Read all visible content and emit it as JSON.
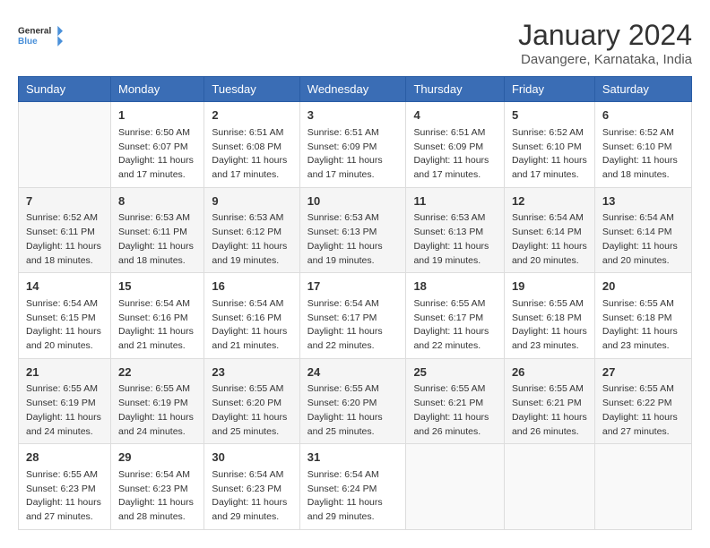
{
  "logo": {
    "general": "General",
    "blue": "Blue"
  },
  "title": "January 2024",
  "subtitle": "Davangere, Karnataka, India",
  "days_of_week": [
    "Sunday",
    "Monday",
    "Tuesday",
    "Wednesday",
    "Thursday",
    "Friday",
    "Saturday"
  ],
  "weeks": [
    [
      {
        "day": "",
        "sunrise": "",
        "sunset": "",
        "daylight": ""
      },
      {
        "day": "1",
        "sunrise": "Sunrise: 6:50 AM",
        "sunset": "Sunset: 6:07 PM",
        "daylight": "Daylight: 11 hours and 17 minutes."
      },
      {
        "day": "2",
        "sunrise": "Sunrise: 6:51 AM",
        "sunset": "Sunset: 6:08 PM",
        "daylight": "Daylight: 11 hours and 17 minutes."
      },
      {
        "day": "3",
        "sunrise": "Sunrise: 6:51 AM",
        "sunset": "Sunset: 6:09 PM",
        "daylight": "Daylight: 11 hours and 17 minutes."
      },
      {
        "day": "4",
        "sunrise": "Sunrise: 6:51 AM",
        "sunset": "Sunset: 6:09 PM",
        "daylight": "Daylight: 11 hours and 17 minutes."
      },
      {
        "day": "5",
        "sunrise": "Sunrise: 6:52 AM",
        "sunset": "Sunset: 6:10 PM",
        "daylight": "Daylight: 11 hours and 17 minutes."
      },
      {
        "day": "6",
        "sunrise": "Sunrise: 6:52 AM",
        "sunset": "Sunset: 6:10 PM",
        "daylight": "Daylight: 11 hours and 18 minutes."
      }
    ],
    [
      {
        "day": "7",
        "sunrise": "Sunrise: 6:52 AM",
        "sunset": "Sunset: 6:11 PM",
        "daylight": "Daylight: 11 hours and 18 minutes."
      },
      {
        "day": "8",
        "sunrise": "Sunrise: 6:53 AM",
        "sunset": "Sunset: 6:11 PM",
        "daylight": "Daylight: 11 hours and 18 minutes."
      },
      {
        "day": "9",
        "sunrise": "Sunrise: 6:53 AM",
        "sunset": "Sunset: 6:12 PM",
        "daylight": "Daylight: 11 hours and 19 minutes."
      },
      {
        "day": "10",
        "sunrise": "Sunrise: 6:53 AM",
        "sunset": "Sunset: 6:13 PM",
        "daylight": "Daylight: 11 hours and 19 minutes."
      },
      {
        "day": "11",
        "sunrise": "Sunrise: 6:53 AM",
        "sunset": "Sunset: 6:13 PM",
        "daylight": "Daylight: 11 hours and 19 minutes."
      },
      {
        "day": "12",
        "sunrise": "Sunrise: 6:54 AM",
        "sunset": "Sunset: 6:14 PM",
        "daylight": "Daylight: 11 hours and 20 minutes."
      },
      {
        "day": "13",
        "sunrise": "Sunrise: 6:54 AM",
        "sunset": "Sunset: 6:14 PM",
        "daylight": "Daylight: 11 hours and 20 minutes."
      }
    ],
    [
      {
        "day": "14",
        "sunrise": "Sunrise: 6:54 AM",
        "sunset": "Sunset: 6:15 PM",
        "daylight": "Daylight: 11 hours and 20 minutes."
      },
      {
        "day": "15",
        "sunrise": "Sunrise: 6:54 AM",
        "sunset": "Sunset: 6:16 PM",
        "daylight": "Daylight: 11 hours and 21 minutes."
      },
      {
        "day": "16",
        "sunrise": "Sunrise: 6:54 AM",
        "sunset": "Sunset: 6:16 PM",
        "daylight": "Daylight: 11 hours and 21 minutes."
      },
      {
        "day": "17",
        "sunrise": "Sunrise: 6:54 AM",
        "sunset": "Sunset: 6:17 PM",
        "daylight": "Daylight: 11 hours and 22 minutes."
      },
      {
        "day": "18",
        "sunrise": "Sunrise: 6:55 AM",
        "sunset": "Sunset: 6:17 PM",
        "daylight": "Daylight: 11 hours and 22 minutes."
      },
      {
        "day": "19",
        "sunrise": "Sunrise: 6:55 AM",
        "sunset": "Sunset: 6:18 PM",
        "daylight": "Daylight: 11 hours and 23 minutes."
      },
      {
        "day": "20",
        "sunrise": "Sunrise: 6:55 AM",
        "sunset": "Sunset: 6:18 PM",
        "daylight": "Daylight: 11 hours and 23 minutes."
      }
    ],
    [
      {
        "day": "21",
        "sunrise": "Sunrise: 6:55 AM",
        "sunset": "Sunset: 6:19 PM",
        "daylight": "Daylight: 11 hours and 24 minutes."
      },
      {
        "day": "22",
        "sunrise": "Sunrise: 6:55 AM",
        "sunset": "Sunset: 6:19 PM",
        "daylight": "Daylight: 11 hours and 24 minutes."
      },
      {
        "day": "23",
        "sunrise": "Sunrise: 6:55 AM",
        "sunset": "Sunset: 6:20 PM",
        "daylight": "Daylight: 11 hours and 25 minutes."
      },
      {
        "day": "24",
        "sunrise": "Sunrise: 6:55 AM",
        "sunset": "Sunset: 6:20 PM",
        "daylight": "Daylight: 11 hours and 25 minutes."
      },
      {
        "day": "25",
        "sunrise": "Sunrise: 6:55 AM",
        "sunset": "Sunset: 6:21 PM",
        "daylight": "Daylight: 11 hours and 26 minutes."
      },
      {
        "day": "26",
        "sunrise": "Sunrise: 6:55 AM",
        "sunset": "Sunset: 6:21 PM",
        "daylight": "Daylight: 11 hours and 26 minutes."
      },
      {
        "day": "27",
        "sunrise": "Sunrise: 6:55 AM",
        "sunset": "Sunset: 6:22 PM",
        "daylight": "Daylight: 11 hours and 27 minutes."
      }
    ],
    [
      {
        "day": "28",
        "sunrise": "Sunrise: 6:55 AM",
        "sunset": "Sunset: 6:23 PM",
        "daylight": "Daylight: 11 hours and 27 minutes."
      },
      {
        "day": "29",
        "sunrise": "Sunrise: 6:54 AM",
        "sunset": "Sunset: 6:23 PM",
        "daylight": "Daylight: 11 hours and 28 minutes."
      },
      {
        "day": "30",
        "sunrise": "Sunrise: 6:54 AM",
        "sunset": "Sunset: 6:23 PM",
        "daylight": "Daylight: 11 hours and 29 minutes."
      },
      {
        "day": "31",
        "sunrise": "Sunrise: 6:54 AM",
        "sunset": "Sunset: 6:24 PM",
        "daylight": "Daylight: 11 hours and 29 minutes."
      },
      {
        "day": "",
        "sunrise": "",
        "sunset": "",
        "daylight": ""
      },
      {
        "day": "",
        "sunrise": "",
        "sunset": "",
        "daylight": ""
      },
      {
        "day": "",
        "sunrise": "",
        "sunset": "",
        "daylight": ""
      }
    ]
  ]
}
